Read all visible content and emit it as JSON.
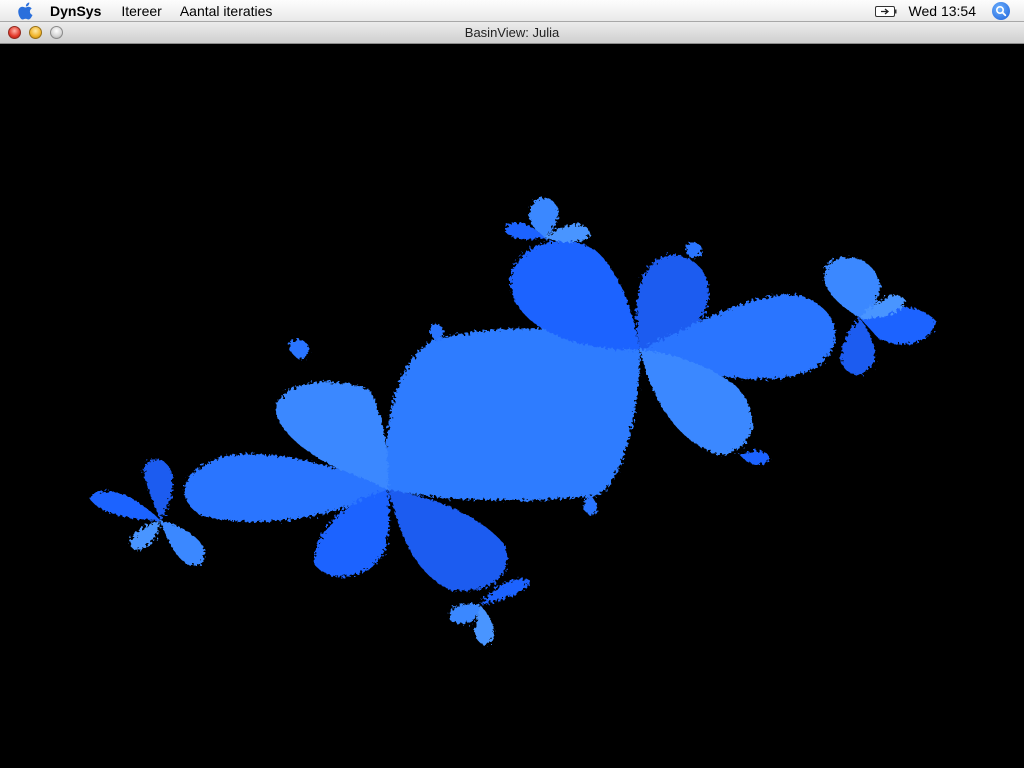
{
  "menubar": {
    "app_name": "DynSys",
    "menus": [
      "Itereer",
      "Aantal iteraties"
    ],
    "clock": "Wed 13:54",
    "icons": [
      "apple-icon",
      "battery-icon",
      "spotlight-icon"
    ]
  },
  "window": {
    "title": "BasinView: Julia"
  },
  "fractal": {
    "background": "#000000",
    "colors": [
      "#2f7bff",
      "#1f63ff",
      "#3a88ff",
      "#1b5cf0",
      "#4a95ff"
    ]
  }
}
